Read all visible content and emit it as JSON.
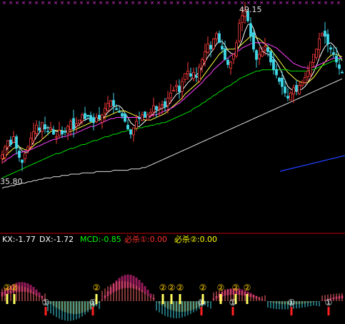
{
  "main_panel": {
    "high_label": "49.15",
    "low_label": "35.80"
  },
  "indicator_panel": {
    "readouts": [
      {
        "text": "KX:-1.77",
        "color": "#ffffff"
      },
      {
        "text": "DX:-1.72",
        "color": "#ffffff"
      },
      {
        "text": "MCD:-0.85",
        "color": "#00ff00"
      },
      {
        "text": "必杀①:0.00",
        "color": "#ff3030"
      },
      {
        "text": "必杀②:0.00",
        "color": "#ffff00"
      }
    ],
    "signal_one": "①",
    "signal_two": "②"
  },
  "colors": {
    "background": "#000000",
    "up": "#ff3c3c",
    "down": "#40d8e8",
    "ma5": "#ffffff",
    "ma10": "#ffff40",
    "ma20": "#ff40ff",
    "ma60": "#00e000",
    "ma120": "#e0e0e0",
    "blue_line": "#2040ff",
    "divider": "#c00000",
    "top_marks": "#ff40ff",
    "area_up": "#b0206a",
    "area_down": "#706a30"
  },
  "chart_data": [
    {
      "type": "candlestick",
      "title": "",
      "price_high": 49.15,
      "price_low": 35.8,
      "closes": [
        37.8,
        38.4,
        38.9,
        38.6,
        39.2,
        38.3,
        37.6,
        37.2,
        37.9,
        38.4,
        39.1,
        39.6,
        40.1,
        39.7,
        40.3,
        39.8,
        39.6,
        39.9,
        39.4,
        39.2,
        39.7,
        39.4,
        39.6,
        40.0,
        40.4,
        39.8,
        40.2,
        40.5,
        40.9,
        40.6,
        40.8,
        40.4,
        40.3,
        40.7,
        40.6,
        40.9,
        41.4,
        41.8,
        42.0,
        41.6,
        41.3,
        41.1,
        40.8,
        40.4,
        39.8,
        39.4,
        39.9,
        40.4,
        40.6,
        40.9,
        40.7,
        40.9,
        41.1,
        41.6,
        41.3,
        41.5,
        41.7,
        41.5,
        42.2,
        42.6,
        42.8,
        43.2,
        42.7,
        43.5,
        44.1,
        44.3,
        43.9,
        44.2,
        43.8,
        44.6,
        45.2,
        45.8,
        46.4,
        46.0,
        46.8,
        47.2,
        46.5,
        46.0,
        45.2,
        44.8,
        45.0,
        45.6,
        46.5,
        48.0,
        48.6,
        49.0,
        48.2,
        47.0,
        46.0,
        45.2,
        45.6,
        45.8,
        46.2,
        45.8,
        45.0,
        44.4,
        44.0,
        43.5,
        43.1,
        42.6,
        42.2,
        42.6,
        43.0,
        42.8,
        43.2,
        43.4,
        43.8,
        44.3,
        45.0,
        45.6,
        46.0,
        46.8,
        47.2,
        47.0,
        46.4,
        46.0,
        45.6,
        45.0,
        44.5,
        44.2
      ],
      "ma_series": [
        {
          "name": "",
          "values": [
            37.6,
            38.0,
            38.4,
            38.6,
            38.8,
            38.7,
            38.4,
            38.1,
            38.0,
            38.0,
            38.4,
            38.8,
            39.2,
            39.5,
            39.8,
            39.9,
            39.9,
            39.9,
            39.7,
            39.6,
            39.6,
            39.6,
            39.6,
            39.7,
            39.8,
            39.8,
            40.0,
            40.1,
            40.4,
            40.5,
            40.6,
            40.6,
            40.6,
            40.6,
            40.6,
            40.6,
            40.8,
            41.1,
            41.3,
            41.5,
            41.6,
            41.6,
            41.4,
            41.0,
            40.7,
            40.3,
            40.1,
            40.0,
            40.0,
            40.2,
            40.4,
            40.6,
            40.8,
            41.0,
            41.2,
            41.3,
            41.4,
            41.5,
            41.6,
            41.9,
            42.2,
            42.5,
            42.6,
            42.8,
            43.1,
            43.4,
            43.6,
            43.9,
            44.0,
            44.2,
            44.6,
            45.0,
            45.4,
            45.7,
            46.0,
            46.4,
            46.6,
            46.6,
            46.3,
            45.9,
            45.7,
            45.6,
            45.8,
            46.2,
            46.7,
            47.4,
            47.9,
            48.0,
            47.6,
            46.9,
            46.4,
            45.9,
            45.7,
            45.6,
            45.5,
            45.3,
            45.0,
            44.6,
            44.1,
            43.6,
            43.1,
            42.9,
            42.8,
            42.7,
            42.8,
            42.9,
            43.1,
            43.4,
            43.8,
            44.2,
            44.7,
            45.3,
            45.8,
            46.2,
            46.4,
            46.5,
            46.3,
            46.0,
            45.5,
            45.1
          ]
        },
        {
          "name": "",
          "values": [
            37.4,
            37.6,
            37.9,
            38.1,
            38.3,
            38.4,
            38.4,
            38.3,
            38.2,
            38.2,
            38.3,
            38.5,
            38.7,
            38.8,
            39.0,
            39.2,
            39.4,
            39.6,
            39.7,
            39.7,
            39.7,
            39.7,
            39.6,
            39.6,
            39.6,
            39.7,
            39.8,
            39.9,
            40.0,
            40.1,
            40.2,
            40.3,
            40.4,
            40.5,
            40.5,
            40.6,
            40.7,
            40.8,
            40.9,
            41.0,
            41.1,
            41.2,
            41.2,
            41.2,
            41.1,
            41.0,
            40.9,
            40.8,
            40.7,
            40.6,
            40.5,
            40.5,
            40.5,
            40.6,
            40.7,
            40.8,
            40.9,
            41.0,
            41.2,
            41.4,
            41.6,
            41.8,
            42.0,
            42.2,
            42.5,
            42.7,
            42.9,
            43.1,
            43.3,
            43.5,
            43.8,
            44.1,
            44.4,
            44.7,
            45.0,
            45.3,
            45.6,
            45.8,
            45.9,
            46.0,
            46.0,
            46.0,
            46.1,
            46.2,
            46.4,
            46.6,
            46.8,
            47.0,
            47.0,
            46.9,
            46.8,
            46.6,
            46.4,
            46.2,
            46.0,
            45.7,
            45.4,
            45.1,
            44.8,
            44.5,
            44.2,
            44.0,
            43.8,
            43.6,
            43.5,
            43.4,
            43.4,
            43.4,
            43.6,
            43.8,
            44.1,
            44.4,
            44.7,
            45.0,
            45.3,
            45.5,
            45.6,
            45.6,
            45.5,
            45.4
          ]
        },
        {
          "name": "",
          "values": [
            37.2,
            37.3,
            37.5,
            37.6,
            37.8,
            37.9,
            38.0,
            38.0,
            38.1,
            38.1,
            38.2,
            38.3,
            38.4,
            38.5,
            38.6,
            38.7,
            38.8,
            38.9,
            39.0,
            39.0,
            39.1,
            39.2,
            39.2,
            39.3,
            39.4,
            39.4,
            39.5,
            39.6,
            39.7,
            39.8,
            39.9,
            40.0,
            40.0,
            40.1,
            40.2,
            40.3,
            40.4,
            40.5,
            40.6,
            40.6,
            40.7,
            40.7,
            40.7,
            40.7,
            40.7,
            40.7,
            40.7,
            40.7,
            40.7,
            40.7,
            40.7,
            40.8,
            40.8,
            40.9,
            40.9,
            41.0,
            41.1,
            41.2,
            41.3,
            41.4,
            41.5,
            41.7,
            41.8,
            42.0,
            42.2,
            42.4,
            42.6,
            42.8,
            43.0,
            43.2,
            43.4,
            43.7,
            43.9,
            44.1,
            44.4,
            44.6,
            44.8,
            45.0,
            45.2,
            45.3,
            45.5,
            45.6,
            45.8,
            45.9,
            46.1,
            46.2,
            46.3,
            46.4,
            46.5,
            46.5,
            46.5,
            46.5,
            46.4,
            46.4,
            46.3,
            46.2,
            46.1,
            45.9,
            45.7,
            45.5,
            45.3,
            45.1,
            44.9,
            44.8,
            44.7,
            44.6,
            44.6,
            44.5,
            44.6,
            44.6,
            44.7,
            44.8,
            44.9,
            45.0,
            45.1,
            45.2,
            45.3,
            45.3,
            45.3,
            45.3
          ]
        },
        {
          "name": "",
          "values": [
            36.0,
            36.1,
            36.2,
            36.3,
            36.4,
            36.5,
            36.6,
            36.7,
            36.8,
            36.9,
            37.0,
            37.1,
            37.2,
            37.3,
            37.4,
            37.5,
            37.6,
            37.7,
            37.8,
            37.9,
            37.9,
            38.0,
            38.1,
            38.2,
            38.3,
            38.3,
            38.4,
            38.5,
            38.6,
            38.6,
            38.7,
            38.8,
            38.9,
            38.9,
            39.0,
            39.1,
            39.2,
            39.2,
            39.3,
            39.4,
            39.4,
            39.5,
            39.6,
            39.6,
            39.7,
            39.7,
            39.8,
            39.8,
            39.9,
            39.9,
            40.0,
            40.0,
            40.1,
            40.1,
            40.2,
            40.2,
            40.3,
            40.3,
            40.4,
            40.5,
            40.6,
            40.7,
            40.8,
            40.9,
            41.0,
            41.1,
            41.2,
            41.4,
            41.5,
            41.6,
            41.8,
            41.9,
            42.1,
            42.2,
            42.4,
            42.5,
            42.7,
            42.8,
            43.0,
            43.1,
            43.2,
            43.4,
            43.5,
            43.7,
            43.8,
            43.9,
            44.0,
            44.1,
            44.2,
            44.3,
            44.3,
            44.4,
            44.4,
            44.4,
            44.4,
            44.4,
            44.4,
            44.4,
            44.4,
            44.4,
            44.4,
            44.3,
            44.3,
            44.3,
            44.3,
            44.3,
            44.3,
            44.3,
            44.4,
            44.4,
            44.5,
            44.6,
            44.7,
            44.8,
            44.9,
            45.0,
            45.1,
            45.1,
            45.2,
            45.2
          ]
        },
        {
          "name": "",
          "values": [
            35.2,
            35.3,
            35.3,
            35.4,
            35.4,
            35.5,
            35.5,
            35.6,
            35.6,
            35.7,
            35.7,
            35.8,
            35.8,
            35.9,
            35.9,
            36.0,
            36.0,
            36.0,
            36.1,
            36.1,
            36.1,
            36.2,
            36.2,
            36.2,
            36.3,
            36.3,
            36.3,
            36.3,
            36.4,
            36.4,
            36.4,
            36.4,
            36.4,
            36.5,
            36.5,
            36.5,
            36.5,
            36.5,
            36.5,
            36.6,
            36.6,
            36.6,
            36.6,
            36.6,
            36.6,
            36.7,
            36.7,
            36.7,
            36.7,
            36.8,
            36.8,
            36.9,
            37.0,
            37.1,
            37.2,
            37.3,
            37.4,
            37.5,
            37.6,
            37.7,
            37.8,
            37.9,
            38.0,
            38.1,
            38.2,
            38.3,
            38.4,
            38.5,
            38.6,
            38.7,
            38.8,
            38.9,
            39.0,
            39.1,
            39.2,
            39.3,
            39.4,
            39.5,
            39.6,
            39.7,
            39.8,
            39.9,
            40.0,
            40.1,
            40.2,
            40.3,
            40.4,
            40.5,
            40.6,
            40.7,
            40.8,
            40.9,
            41.0,
            41.1,
            41.2,
            41.3,
            41.4,
            41.5,
            41.6,
            41.7,
            41.8,
            41.9,
            42.0,
            42.1,
            42.2,
            42.3,
            42.4,
            42.5,
            42.6,
            42.7,
            42.8,
            42.9,
            43.0,
            43.1,
            43.2,
            43.3,
            43.4,
            43.5,
            43.6,
            43.7
          ]
        }
      ]
    },
    {
      "type": "bar",
      "title": "",
      "kx": -1.77,
      "dx": -1.72,
      "mcd": -0.85,
      "bisha1": 0.0,
      "bisha2": 0.0
    }
  ]
}
